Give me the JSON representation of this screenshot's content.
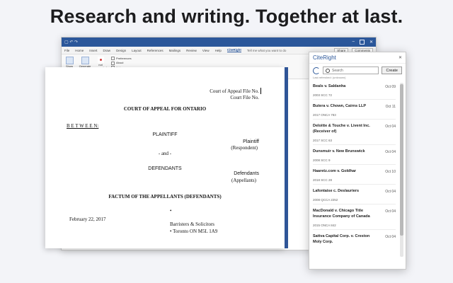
{
  "headline": "Research and writing. Together at last.",
  "word": {
    "tabs": [
      "File",
      "Home",
      "Insert",
      "Draw",
      "Design",
      "Layout",
      "References",
      "Mailings",
      "Review",
      "View",
      "Help",
      "CiteRight"
    ],
    "active_tab": "CiteRight",
    "tell_me": "Tell me what you want to do",
    "share": "Share",
    "comments": "Comments",
    "ribbon": {
      "btn1": "Show CiteRight",
      "btn2": "Generate ToA",
      "btn3": "not generated",
      "options": [
        "Preferences",
        "About",
        "Help"
      ]
    }
  },
  "doc": {
    "file_line1": "Court of Appeal File No.",
    "file_line2": "Court File No.",
    "court": "COURT OF APPEAL FOR ONTARIO",
    "between": "B E T W E E N:",
    "plaintiff": "PLAINTIFF",
    "plaintiff_role": "Plaintiff",
    "plaintiff_sub": "(Respondent)",
    "and": "- and -",
    "defendants": "DEFENDANTS",
    "defendants_role": "Defendants",
    "defendants_sub": "(Appellants)",
    "factum": "FACTUM OF THE APPELLANTS (DEFENDANTS)",
    "date": "February 22, 2017",
    "bullet1": "•",
    "barristers": "Barristers & Solicitors",
    "toronto": "• Toronto ON  M5L 1A9"
  },
  "pane": {
    "title": "CiteRight",
    "search_placeholder": "Search",
    "create": "Create",
    "last_refreshed": "Last refreshed: (unknown)",
    "items": [
      {
        "name": "Beals v. Saldanha",
        "date": "Oct 09",
        "cite": "2003 SCC 72"
      },
      {
        "name": "Butera v. Chown, Cairns LLP",
        "date": "Oct 11",
        "cite": "2017 ONCA 783"
      },
      {
        "name": "Deloitte & Touche v. Livent Inc. (Receiver of)",
        "date": "Oct 04",
        "cite": "2017 SCC 63"
      },
      {
        "name": "Dunsmuir v. New Brunswick",
        "date": "Oct 04",
        "cite": "2008 SCC 9"
      },
      {
        "name": "Haaretz.com v. Goldhar",
        "date": "Oct 10",
        "cite": "2018 SCC 28"
      },
      {
        "name": "Lafontaise c. Deslauriers",
        "date": "Oct 04",
        "cite": "2008 QCCA 2252"
      },
      {
        "name": "MacDonald v. Chicago Title Insurance Company of Canada",
        "date": "Oct 04",
        "cite": "2015 ONCA 842"
      },
      {
        "name": "Sattva Capital Corp. v. Creston Moly Corp.",
        "date": "Oct 04",
        "cite": ""
      }
    ]
  }
}
